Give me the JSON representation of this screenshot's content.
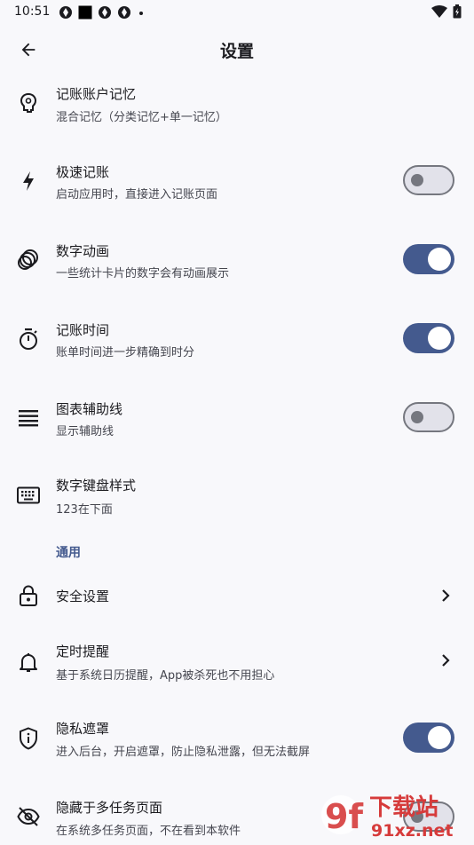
{
  "status_bar": {
    "time": "10:51"
  },
  "app_bar": {
    "title": "设置"
  },
  "settings": [
    {
      "title": "记账账户记忆",
      "subtitle": "混合记忆（分类记忆+单一记忆）",
      "icon": "brain-bulb-icon",
      "control": "none"
    },
    {
      "title": "极速记账",
      "subtitle": "启动应用时，直接进入记账页面",
      "icon": "lightning-icon",
      "control": "toggle",
      "on": false
    },
    {
      "title": "数字动画",
      "subtitle": "一些统计卡片的数字会有动画展示",
      "icon": "animation-rings-icon",
      "control": "toggle",
      "on": true
    },
    {
      "title": "记账时间",
      "subtitle": "账单时间进一步精确到时分",
      "icon": "timer-icon",
      "control": "toggle",
      "on": true
    },
    {
      "title": "图表辅助线",
      "subtitle": "显示辅助线",
      "icon": "lines-icon",
      "control": "toggle",
      "on": false
    },
    {
      "title": "数字键盘样式",
      "subtitle": "123在下面",
      "icon": "keyboard-icon",
      "control": "none"
    }
  ],
  "section_general": {
    "label": "通用"
  },
  "general": [
    {
      "title": "安全设置",
      "subtitle": "",
      "icon": "lock-icon",
      "control": "chevron"
    },
    {
      "title": "定时提醒",
      "subtitle": "基于系统日历提醒，App被杀死也不用担心",
      "icon": "bell-icon",
      "control": "chevron"
    },
    {
      "title": "隐私遮罩",
      "subtitle": "进入后台，开启遮罩，防止隐私泄露，但无法截屏",
      "icon": "privacy-shield-icon",
      "control": "toggle",
      "on": true
    },
    {
      "title": "隐藏于多任务页面",
      "subtitle": "在系统多任务页面，不在看到本软件",
      "icon": "eye-off-icon",
      "control": "toggle",
      "on": false
    }
  ],
  "watermark": {
    "brand": "下载站",
    "url": "91xz.net",
    "logo": "9f"
  },
  "colors": {
    "accent": "#445a8e",
    "background": "#f8f8fb",
    "text": "#1b1b1f",
    "subtext": "#45464f",
    "watermark": "#d63b3b"
  }
}
